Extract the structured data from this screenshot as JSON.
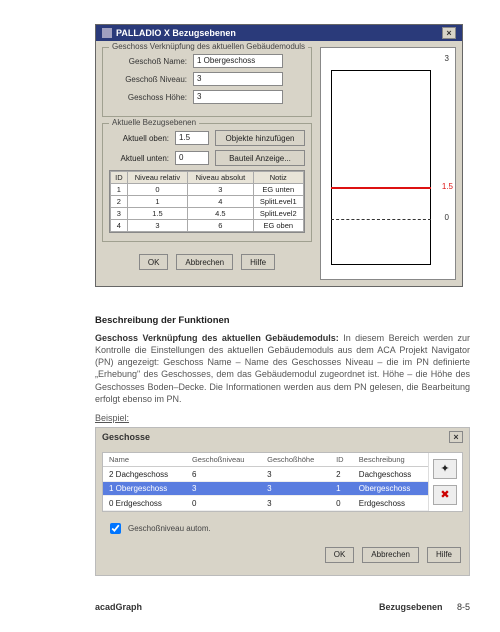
{
  "dlg1": {
    "title": "PALLADIO X Bezugsebenen",
    "group1": {
      "title": "Geschoss Verknüpfung des aktuellen Gebäudemoduls",
      "name_lbl": "Geschoß Name:",
      "name_val": "1 Obergeschoss",
      "niveau_lbl": "Geschoß Niveau:",
      "niveau_val": "3",
      "hoehe_lbl": "Geschoss Höhe:",
      "hoehe_val": "3"
    },
    "group2": {
      "title": "Aktuelle Bezugsebenen",
      "oben_lbl": "Aktuell oben:",
      "oben_val": "1.5",
      "unten_lbl": "Aktuell unten:",
      "unten_val": "0",
      "btn_add": "Objekte hinzufügen",
      "btn_show": "Bauteil Anzeige..."
    },
    "table": {
      "headers": [
        "ID",
        "Niveau relativ",
        "Niveau absolut",
        "Notiz"
      ],
      "rows": [
        [
          "1",
          "0",
          "3",
          "EG unten"
        ],
        [
          "2",
          "1",
          "4",
          "SplitLevel1"
        ],
        [
          "3",
          "1.5",
          "4.5",
          "SplitLevel2"
        ],
        [
          "4",
          "3",
          "6",
          "EG oben"
        ]
      ]
    },
    "preview": {
      "top": "3",
      "red": "1.5",
      "zero": "0"
    },
    "buttons": {
      "ok": "OK",
      "cancel": "Abbrechen",
      "help": "Hilfe"
    }
  },
  "body": {
    "h": "Beschreibung der Funktionen",
    "p": "Geschoss Verknüpfung des aktuellen Gebäudemoduls: In diesem Bereich werden zur Kontrolle die Einstellungen des aktuellen Gebäudemoduls aus dem ACA Projekt Navigator (PN) angezeigt: Geschoss Name – Name des Geschosses Niveau – die im PN definierte „Erhebung\" des Geschosses, dem das Gebäudemodul zugeordnet ist. Höhe – die Höhe des Geschosses Boden–Decke. Die Informationen werden aus dem PN gelesen, die Bearbeitung erfolgt ebenso im PN.",
    "p_lead": "Geschoss Verknüpfung des aktuellen Gebäudemoduls:",
    "p_rest": " In diesem Bereich werden zur Kontrolle die Einstellungen des aktuellen Gebäudemoduls aus dem ACA Projekt Navigator (PN) angezeigt: Geschoss Name – Name des Geschosses Niveau – die im PN definierte „Erhebung\" des Geschosses, dem das Gebäudemodul zugeordnet ist. Höhe – die Höhe des Geschosses Boden–Decke. Die Informationen werden aus dem PN gelesen, die Bearbeitung erfolgt ebenso im PN.",
    "beispiel": "Beispiel:"
  },
  "dlg2": {
    "title": "Geschosse",
    "headers": [
      "Name",
      "Geschoßniveau",
      "Geschoßhöhe",
      "ID",
      "Beschreibung"
    ],
    "rows": [
      {
        "cells": [
          "2 Dachgeschoss",
          "6",
          "3",
          "2",
          "Dachgeschoss"
        ],
        "sel": false
      },
      {
        "cells": [
          "1 Obergeschoss",
          "3",
          "3",
          "1",
          "Obergeschoss"
        ],
        "sel": true
      },
      {
        "cells": [
          "0 Erdgeschoss",
          "0",
          "3",
          "0",
          "Erdgeschoss"
        ],
        "sel": false
      }
    ],
    "chk": "Geschoßniveau autom.",
    "buttons": {
      "ok": "OK",
      "cancel": "Abbrechen",
      "help": "Hilfe"
    }
  },
  "footer": {
    "left": "acadGraph",
    "right_label": "Bezugsebenen",
    "page": "8-5"
  }
}
